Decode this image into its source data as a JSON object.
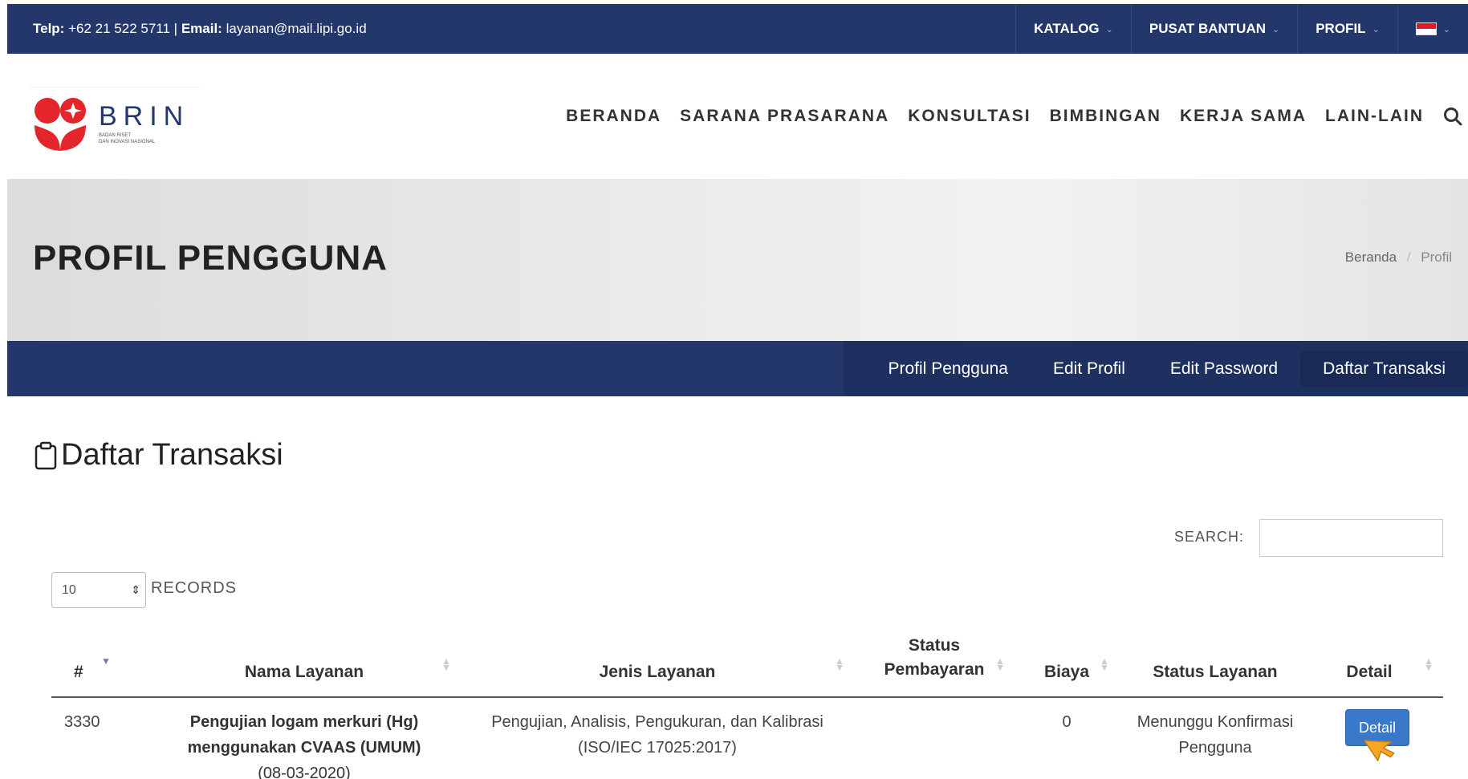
{
  "topbar": {
    "phone_label": "Telp:",
    "phone": "+62 21 522 5711",
    "sep": "|",
    "email_label": "Email:",
    "email": "layanan@mail.lipi.go.id",
    "menu": [
      {
        "label": "KATALOG"
      },
      {
        "label": "PUSAT BANTUAN"
      },
      {
        "label": "PROFIL"
      }
    ]
  },
  "logo": {
    "name": "BRIN",
    "sub1": "BADAN RISET",
    "sub2": "DAN INOVASI NASIONAL"
  },
  "mainnav": [
    "BERANDA",
    "SARANA PRASARANA",
    "KONSULTASI",
    "BIMBINGAN",
    "KERJA SAMA",
    "LAIN-LAIN"
  ],
  "banner": {
    "title": "PROFIL PENGGUNA",
    "breadcrumb": {
      "home": "Beranda",
      "sep": "/",
      "current": "Profil"
    }
  },
  "subnav": {
    "tabs": [
      "Profil Pengguna",
      "Edit Profil",
      "Edit Password",
      "Daftar Transaksi"
    ],
    "active": "Daftar Transaksi"
  },
  "section_title": "Daftar Transaksi",
  "search": {
    "label": "SEARCH:",
    "value": ""
  },
  "records": {
    "value": "10",
    "label": "RECORDS"
  },
  "table": {
    "headers": [
      "#",
      "Nama Layanan",
      "Jenis Layanan",
      "Status Pembayaran",
      "Biaya",
      "Status Layanan",
      "Detail"
    ],
    "rows": [
      {
        "id": "3330",
        "name_line1": "Pengujian logam merkuri (Hg)",
        "name_line2": "menggunakan CVAAS (UMUM)",
        "name_line3": "(08-03-2020)",
        "jenis_line1": "Pengujian, Analisis, Pengukuran, dan Kalibrasi",
        "jenis_line2": "(ISO/IEC 17025:2017)",
        "status_pembayaran": "",
        "biaya": "0",
        "status_line1": "Menunggu Konfirmasi",
        "status_line2": "Pengguna",
        "detail": "Detail"
      }
    ]
  },
  "colors": {
    "navy": "#23376b",
    "button": "#3a79c9",
    "cursor": "#f5a623"
  }
}
